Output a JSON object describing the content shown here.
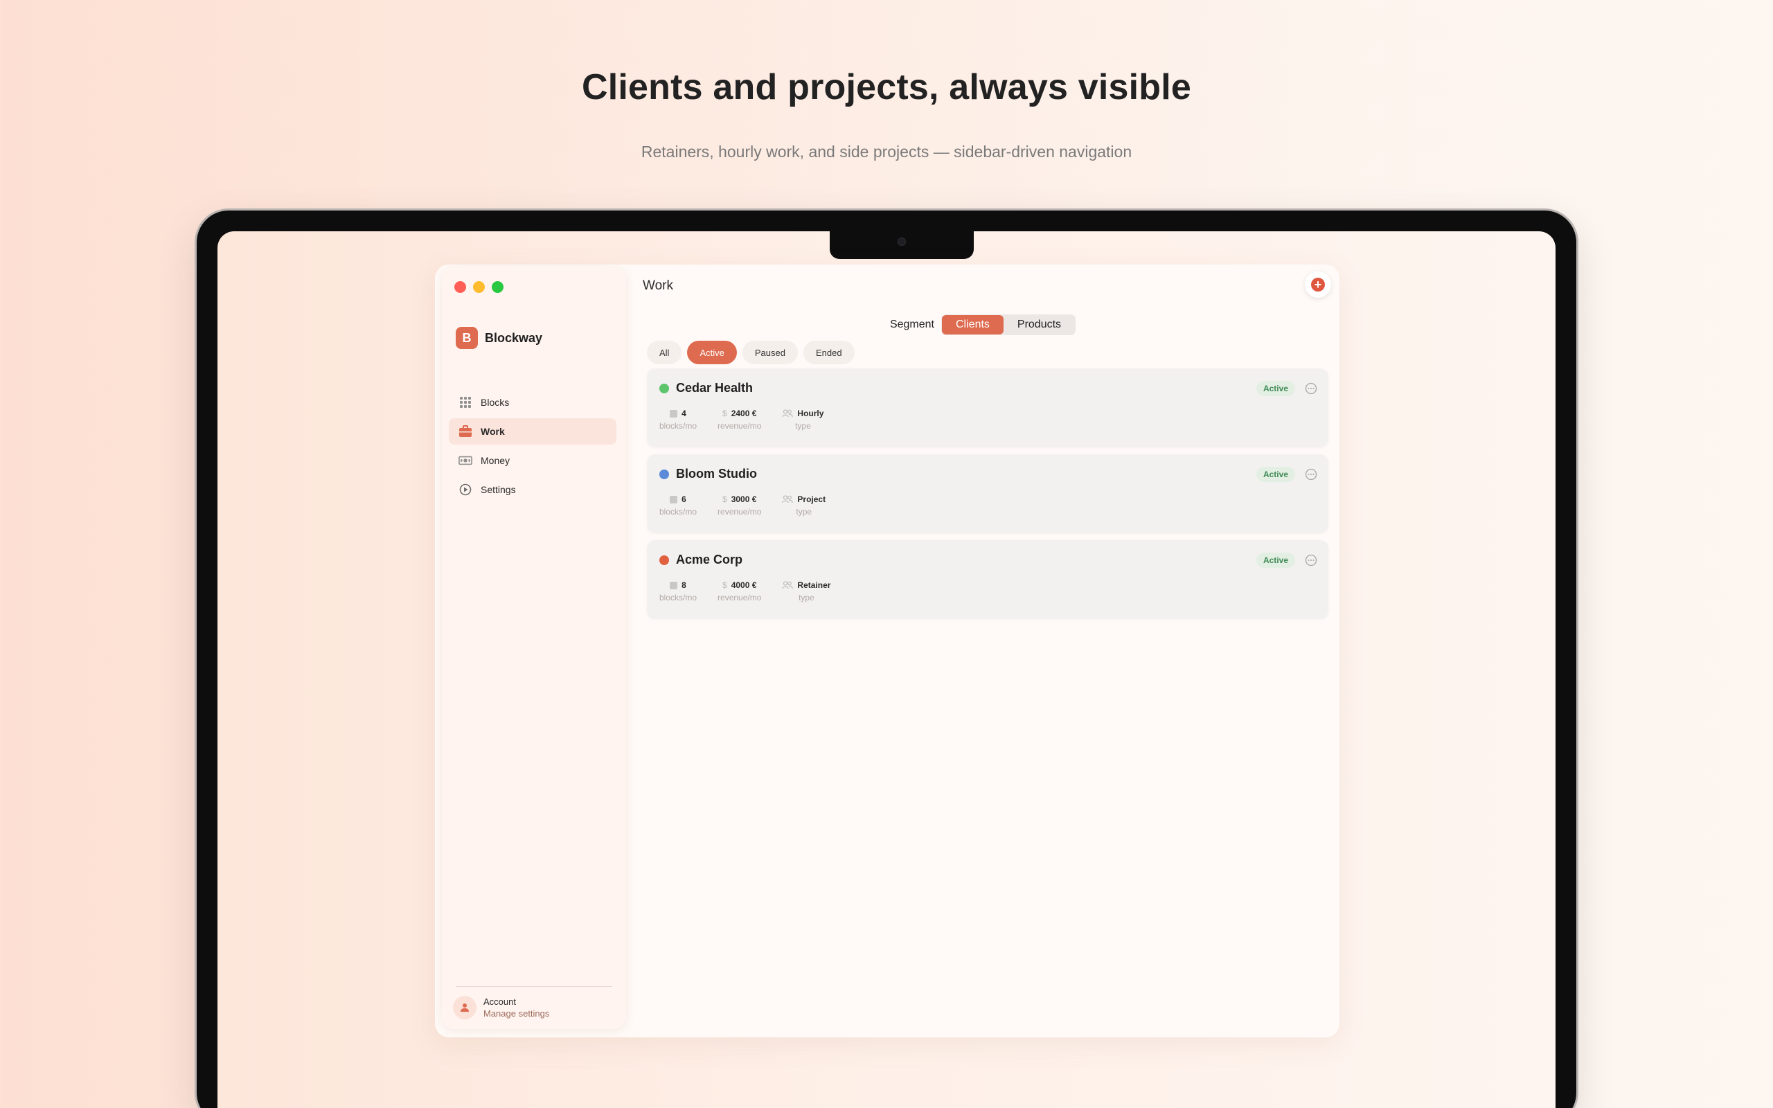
{
  "hero": {
    "title": "Clients and projects, always visible",
    "subtitle": "Retainers, hourly work, and side projects — sidebar-driven navigation"
  },
  "sidebar": {
    "brand": {
      "logo_letter": "B",
      "name": "Blockway"
    },
    "items": [
      {
        "label": "Blocks",
        "icon": "grid-icon",
        "active": false
      },
      {
        "label": "Work",
        "icon": "briefcase-icon",
        "active": true
      },
      {
        "label": "Money",
        "icon": "banknote-icon",
        "active": false
      },
      {
        "label": "Settings",
        "icon": "play-circle-icon",
        "active": false
      }
    ],
    "account": {
      "name": "Account",
      "subtitle": "Manage settings"
    }
  },
  "main": {
    "title": "Work",
    "segment": {
      "label": "Segment",
      "options": [
        "Clients",
        "Products"
      ],
      "selected": "Clients"
    },
    "filters": [
      "All",
      "Active",
      "Paused",
      "Ended"
    ],
    "active_filter": "Active",
    "clients": [
      {
        "name": "Cedar Health",
        "dot_color": "#5cc46a",
        "status": "Active",
        "blocks": "4",
        "blocks_label": "blocks/mo",
        "revenue": "2400 €",
        "revenue_label": "revenue/mo",
        "type": "Hourly",
        "type_label": "type"
      },
      {
        "name": "Bloom Studio",
        "dot_color": "#5a8ad8",
        "status": "Active",
        "blocks": "6",
        "blocks_label": "blocks/mo",
        "revenue": "3000 €",
        "revenue_label": "revenue/mo",
        "type": "Project",
        "type_label": "type"
      },
      {
        "name": "Acme Corp",
        "dot_color": "#e0603f",
        "status": "Active",
        "blocks": "8",
        "blocks_label": "blocks/mo",
        "revenue": "4000 €",
        "revenue_label": "revenue/mo",
        "type": "Retainer",
        "type_label": "type"
      }
    ]
  },
  "colors": {
    "accent": "#de6a4f",
    "status_active_bg": "#e3efe3",
    "status_active_text": "#3f8a55"
  }
}
